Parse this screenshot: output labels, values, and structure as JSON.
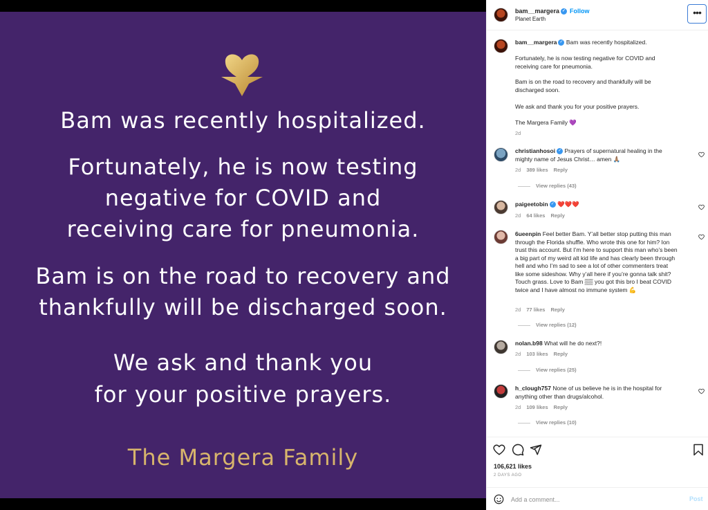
{
  "media": {
    "lines": [
      "Bam was recently hospitalized.",
      "Fortunately, he is now testing",
      "negative for COVID and",
      "receiving care for pneumonia.",
      "Bam is on the road to recovery and",
      "thankfully will be discharged soon.",
      "We ask and thank you",
      "for your positive prayers.",
      "The Margera Family"
    ],
    "background": "#44246a",
    "gold": "#d8b56c"
  },
  "header": {
    "username": "bam__margera",
    "follow_label": "Follow",
    "location": "Planet Earth",
    "more_label": "•••"
  },
  "caption": {
    "username": "bam__margera",
    "paragraphs": [
      "Bam was recently hospitalized.",
      "Fortunately, he is now testing negative for COVID and receiving care for pneumonia.",
      "Bam is on the road to recovery and thankfully will be discharged soon.",
      "We ask and thank you for your positive prayers.",
      "The Margera Family 💜"
    ],
    "time": "2d"
  },
  "comments": [
    {
      "username": "christianhosoi",
      "verified": true,
      "text": "Prayers of supernatural healing in the mighty name of Jesus Christ… amen 🙏🏽",
      "time": "2d",
      "likes": "389 likes",
      "reply": "Reply",
      "view_replies": "View replies (43)"
    },
    {
      "username": "paigeetobin",
      "verified": true,
      "text": "❤️❤️❤️",
      "time": "2d",
      "likes": "64 likes",
      "reply": "Reply",
      "view_replies": ""
    },
    {
      "username": "6ueenpin",
      "verified": false,
      "text": "Feel better Bam. Y’all better stop putting this man through the Florida shuffle. Who wrote this one for him? Ion trust this account. But I’m here to support this man who’s been a big part of my weird alt kid life and has clearly been through hell and who I’m sad to see a lot of other commenters treat like some sideshow. Why y’all here if you’re gonna talk shit? Touch grass. Love to Bam ▒▒ you got this bro I beat COVID twice and I have almost no immune system 💪",
      "time": "2d",
      "likes": "77 likes",
      "reply": "Reply",
      "view_replies": "View replies (12)"
    },
    {
      "username": "nolan.b98",
      "verified": false,
      "text": "What will he do next?!",
      "time": "2d",
      "likes": "103 likes",
      "reply": "Reply",
      "view_replies": "View replies (25)"
    },
    {
      "username": "h_clough757",
      "verified": false,
      "text": "None of us believe he is in the hospital for anything other than drugs/alcohol.",
      "time": "2d",
      "likes": "109 likes",
      "reply": "Reply",
      "view_replies": "View replies (10)"
    }
  ],
  "footer": {
    "likes": "106,621 likes",
    "date": "2 DAYS AGO",
    "comment_placeholder": "Add a comment...",
    "post_label": "Post"
  }
}
